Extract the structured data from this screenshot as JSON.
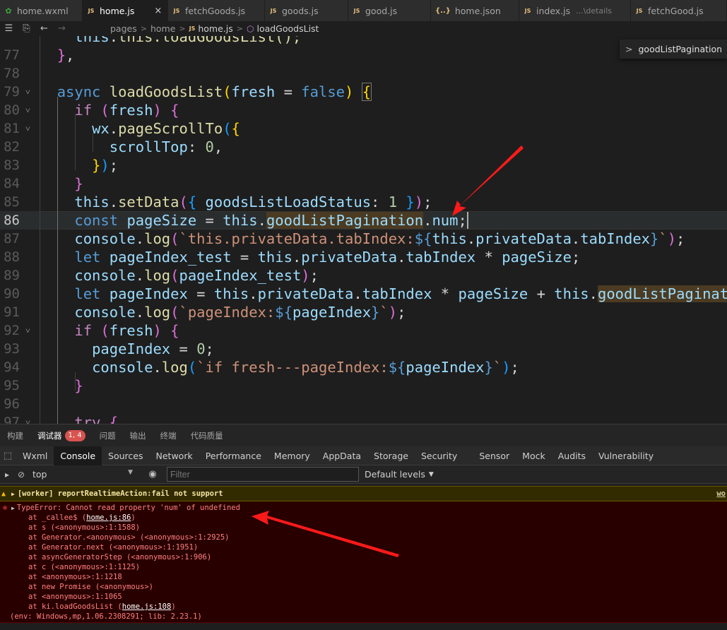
{
  "tabs": [
    {
      "label": "home.wxml",
      "icon": "wxml",
      "active": false
    },
    {
      "label": "home.js",
      "icon": "js",
      "active": true
    },
    {
      "label": "fetchGoods.js",
      "icon": "js",
      "active": false
    },
    {
      "label": "goods.js",
      "icon": "js",
      "active": false
    },
    {
      "label": "good.js",
      "icon": "js",
      "active": false
    },
    {
      "label": "home.json",
      "icon": "json",
      "active": false
    },
    {
      "label": "index.js",
      "icon": "js",
      "active": false,
      "description": "...\\details"
    },
    {
      "label": "fetchGood.js",
      "icon": "js",
      "active": false
    }
  ],
  "tab_icons": {
    "js": "JS",
    "wxml": "✿",
    "json": "{..}"
  },
  "tab_close": "×",
  "breadcrumb": {
    "items": [
      "pages",
      "home",
      "home.js",
      "loadGoodsList"
    ]
  },
  "outline": {
    "label": "goodListPagination"
  },
  "editor": {
    "current_line": 86,
    "line_numbers": [
      "77",
      "78",
      "79",
      "80",
      "81",
      "82",
      "83",
      "84",
      "85",
      "86",
      "87",
      "88",
      "89",
      "90",
      "91",
      "92",
      "93",
      "94",
      "95",
      "96",
      "97"
    ],
    "folds": [
      "79",
      "80",
      "81",
      "92",
      "97"
    ],
    "top_fragment": "this.loadGoodsList();"
  },
  "bottom_tabs": [
    {
      "label": "构建",
      "active": false
    },
    {
      "label": "调试器",
      "active": true,
      "badge": "1, 4"
    },
    {
      "label": "问题",
      "active": false
    },
    {
      "label": "输出",
      "active": false
    },
    {
      "label": "终端",
      "active": false
    },
    {
      "label": "代码质量",
      "active": false
    }
  ],
  "devtools_tabs": [
    "Wxml",
    "Console",
    "Sources",
    "Network",
    "Performance",
    "Memory",
    "AppData",
    "Storage",
    "Security",
    "Sensor",
    "Mock",
    "Audits",
    "Vulnerability"
  ],
  "devtools_active": "Console",
  "console_toolbar": {
    "context": "top",
    "filter_placeholder": "Filter",
    "levels": "Default levels"
  },
  "console": {
    "warning": {
      "text": "[worker] reportRealtimeAction:fail not support",
      "source": "wo"
    },
    "error": {
      "message": "TypeError: Cannot read property 'num' of undefined",
      "stack": [
        {
          "prefix": "at _callee$ (",
          "link": "home.js:86",
          "suffix": ")"
        },
        {
          "prefix": "at s (<anonymous>:1:1588)",
          "link": "",
          "suffix": ""
        },
        {
          "prefix": "at Generator.<anonymous> (<anonymous>:1:2925)",
          "link": "",
          "suffix": ""
        },
        {
          "prefix": "at Generator.next (<anonymous>:1:1951)",
          "link": "",
          "suffix": ""
        },
        {
          "prefix": "at asyncGeneratorStep (<anonymous>:1:906)",
          "link": "",
          "suffix": ""
        },
        {
          "prefix": "at c (<anonymous>:1:1125)",
          "link": "",
          "suffix": ""
        },
        {
          "prefix": "at <anonymous>:1:1218",
          "link": "",
          "suffix": ""
        },
        {
          "prefix": "at new Promise (<anonymous>)",
          "link": "",
          "suffix": ""
        },
        {
          "prefix": "at <anonymous>:1:1065",
          "link": "",
          "suffix": ""
        },
        {
          "prefix": "at ki.loadGoodsList (",
          "link": "home.js:108",
          "suffix": ")"
        }
      ],
      "env": "(env: Windows,mp,1.06.2308291; lib: 2.23.1)"
    }
  },
  "colors": {
    "annotation_arrow": "#ff1a1a",
    "error_background": "#290000",
    "warning_background": "#332b00",
    "badge": "#d9534f"
  }
}
